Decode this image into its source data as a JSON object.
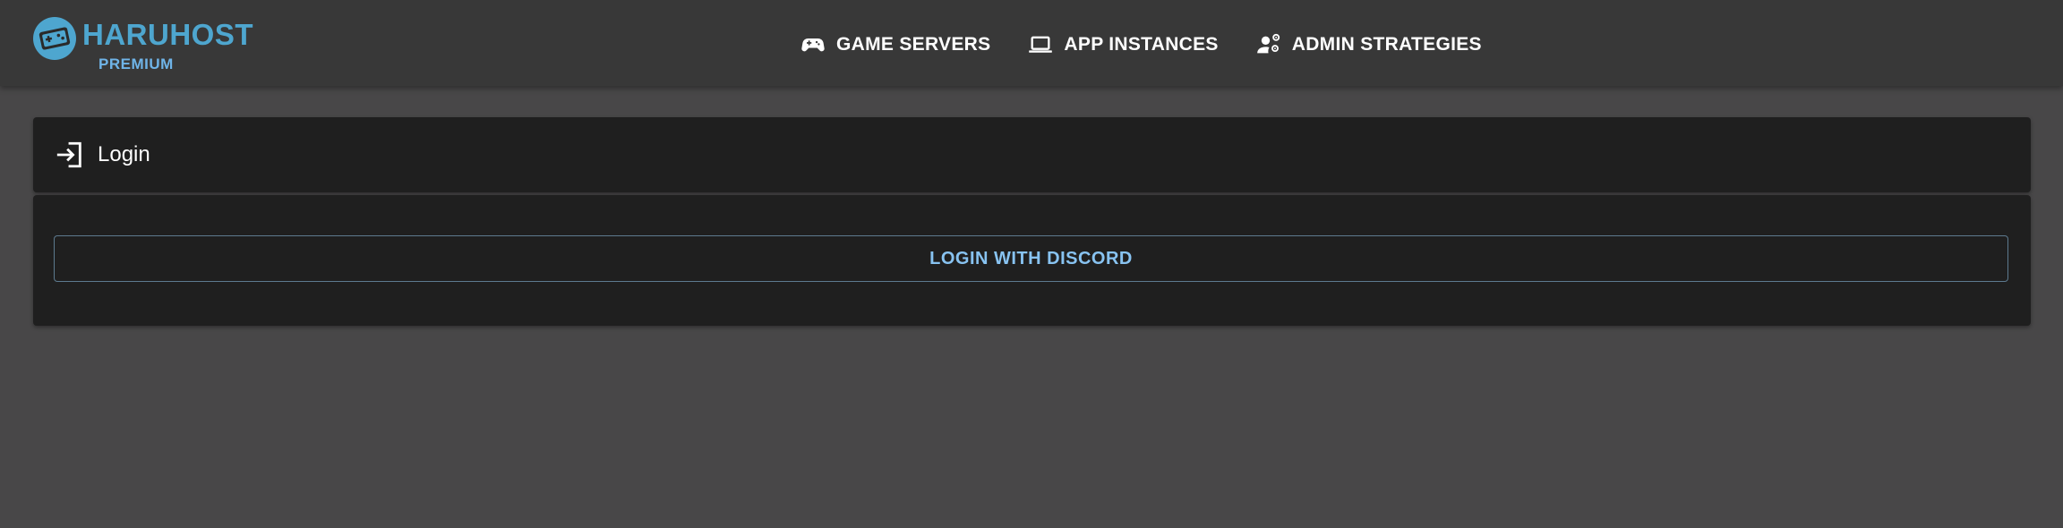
{
  "brand": {
    "name": "HARUHOST",
    "tier": "PREMIUM",
    "logo_icon": "gamepad-circle-logo",
    "color": "#4ea6cf"
  },
  "nav": {
    "items": [
      {
        "label": "GAME SERVERS",
        "icon": "gamepad-icon"
      },
      {
        "label": "APP INSTANCES",
        "icon": "laptop-icon"
      },
      {
        "label": "ADMIN STRATEGIES",
        "icon": "admin-user-gear-icon"
      }
    ]
  },
  "login_card": {
    "title": "Login",
    "icon": "login-icon",
    "discord_button": "LOGIN WITH DISCORD"
  },
  "colors": {
    "page_background": "#484748",
    "topbar": "#383838",
    "card": "#1f1f1f",
    "accent": "#88c3f1"
  }
}
